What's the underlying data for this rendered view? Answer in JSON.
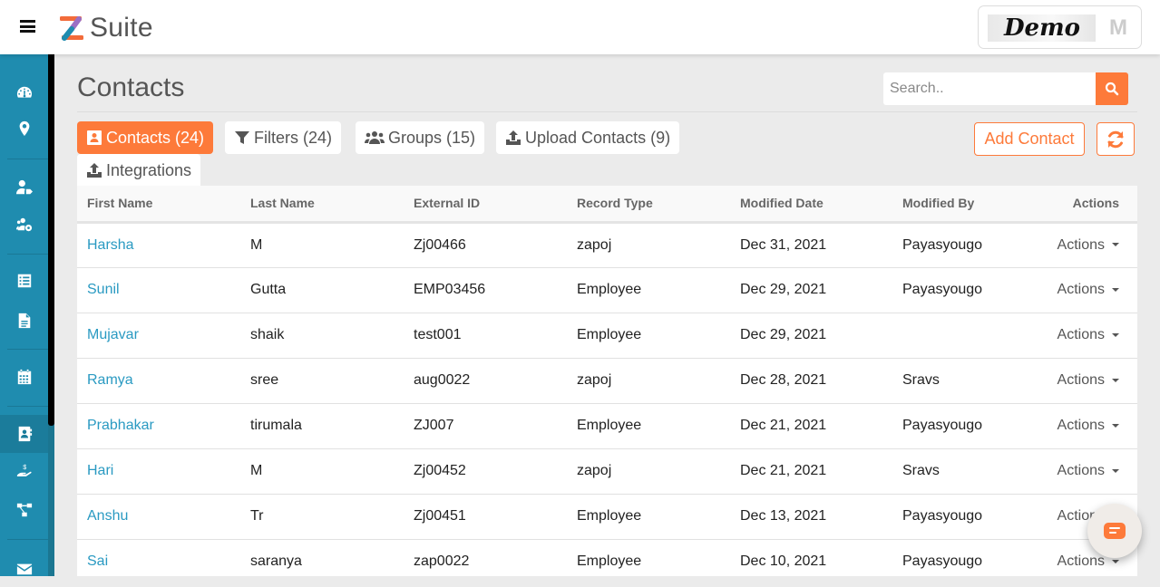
{
  "header": {
    "brand": "Suite",
    "brand_mark": "Z",
    "profile_logo_text": "Demo",
    "profile_avatar_initial": "M"
  },
  "sidebar": {
    "items": [
      {
        "icon": "dashboard-icon",
        "active": false
      },
      {
        "icon": "map-marker-icon",
        "active": false
      },
      {
        "icon": "user-tag-icon",
        "active": false
      },
      {
        "icon": "users-cog-icon",
        "active": false
      },
      {
        "icon": "list-icon",
        "active": false
      },
      {
        "icon": "file-icon",
        "active": false
      },
      {
        "icon": "calendar-icon",
        "active": false
      },
      {
        "icon": "address-book-icon",
        "active": true
      },
      {
        "icon": "hand-dollar-icon",
        "active": false
      },
      {
        "icon": "sitemap-icon",
        "active": false
      },
      {
        "icon": "envelope-icon",
        "active": false
      }
    ]
  },
  "page": {
    "title": "Contacts",
    "search_placeholder": "Search..",
    "search_value": "",
    "add_contact_label": "Add Contact"
  },
  "tabs": [
    {
      "label": "Contacts (24)",
      "icon": "address-card-icon",
      "active": true
    },
    {
      "label": "Filters (24)",
      "icon": "filter-icon",
      "active": false
    },
    {
      "label": "Groups (15)",
      "icon": "users-icon",
      "active": false
    },
    {
      "label": "Upload Contacts (9)",
      "icon": "upload-icon",
      "active": false
    },
    {
      "label": "Integrations",
      "icon": "upload-icon",
      "active": false
    }
  ],
  "table": {
    "columns": [
      "First Name",
      "Last Name",
      "External ID",
      "Record Type",
      "Modified Date",
      "Modified By",
      "Actions"
    ],
    "rows": [
      {
        "first": "Harsha",
        "last": "M",
        "ext_id": "Zj00466",
        "type": "zapoj",
        "date": "Dec 31, 2021",
        "by": "Payasyougo",
        "action": "Actions"
      },
      {
        "first": "Sunil",
        "last": "Gutta",
        "ext_id": "EMP03456",
        "type": "Employee",
        "date": "Dec 29, 2021",
        "by": "Payasyougo",
        "action": "Actions"
      },
      {
        "first": "Mujavar",
        "last": "shaik",
        "ext_id": "test001",
        "type": "Employee",
        "date": "Dec 29, 2021",
        "by": "",
        "action": "Actions"
      },
      {
        "first": "Ramya",
        "last": "sree",
        "ext_id": "aug0022",
        "type": "zapoj",
        "date": "Dec 28, 2021",
        "by": "Sravs",
        "action": "Actions"
      },
      {
        "first": "Prabhakar",
        "last": "tirumala",
        "ext_id": "ZJ007",
        "type": "Employee",
        "date": "Dec 21, 2021",
        "by": "Payasyougo",
        "action": "Actions"
      },
      {
        "first": "Hari",
        "last": "M",
        "ext_id": "Zj00452",
        "type": "zapoj",
        "date": "Dec 21, 2021",
        "by": "Sravs",
        "action": "Actions"
      },
      {
        "first": "Anshu",
        "last": "Tr",
        "ext_id": "Zj00451",
        "type": "Employee",
        "date": "Dec 13, 2021",
        "by": "Payasyougo",
        "action": "Actions"
      },
      {
        "first": "Sai",
        "last": "saranya",
        "ext_id": "zap0022",
        "type": "Employee",
        "date": "Dec 10, 2021",
        "by": "Payasyougo",
        "action": "Actions"
      }
    ]
  },
  "colors": {
    "accent": "#fd7a3a",
    "sidebar": "#1f8caf",
    "link": "#2a9ac2"
  }
}
